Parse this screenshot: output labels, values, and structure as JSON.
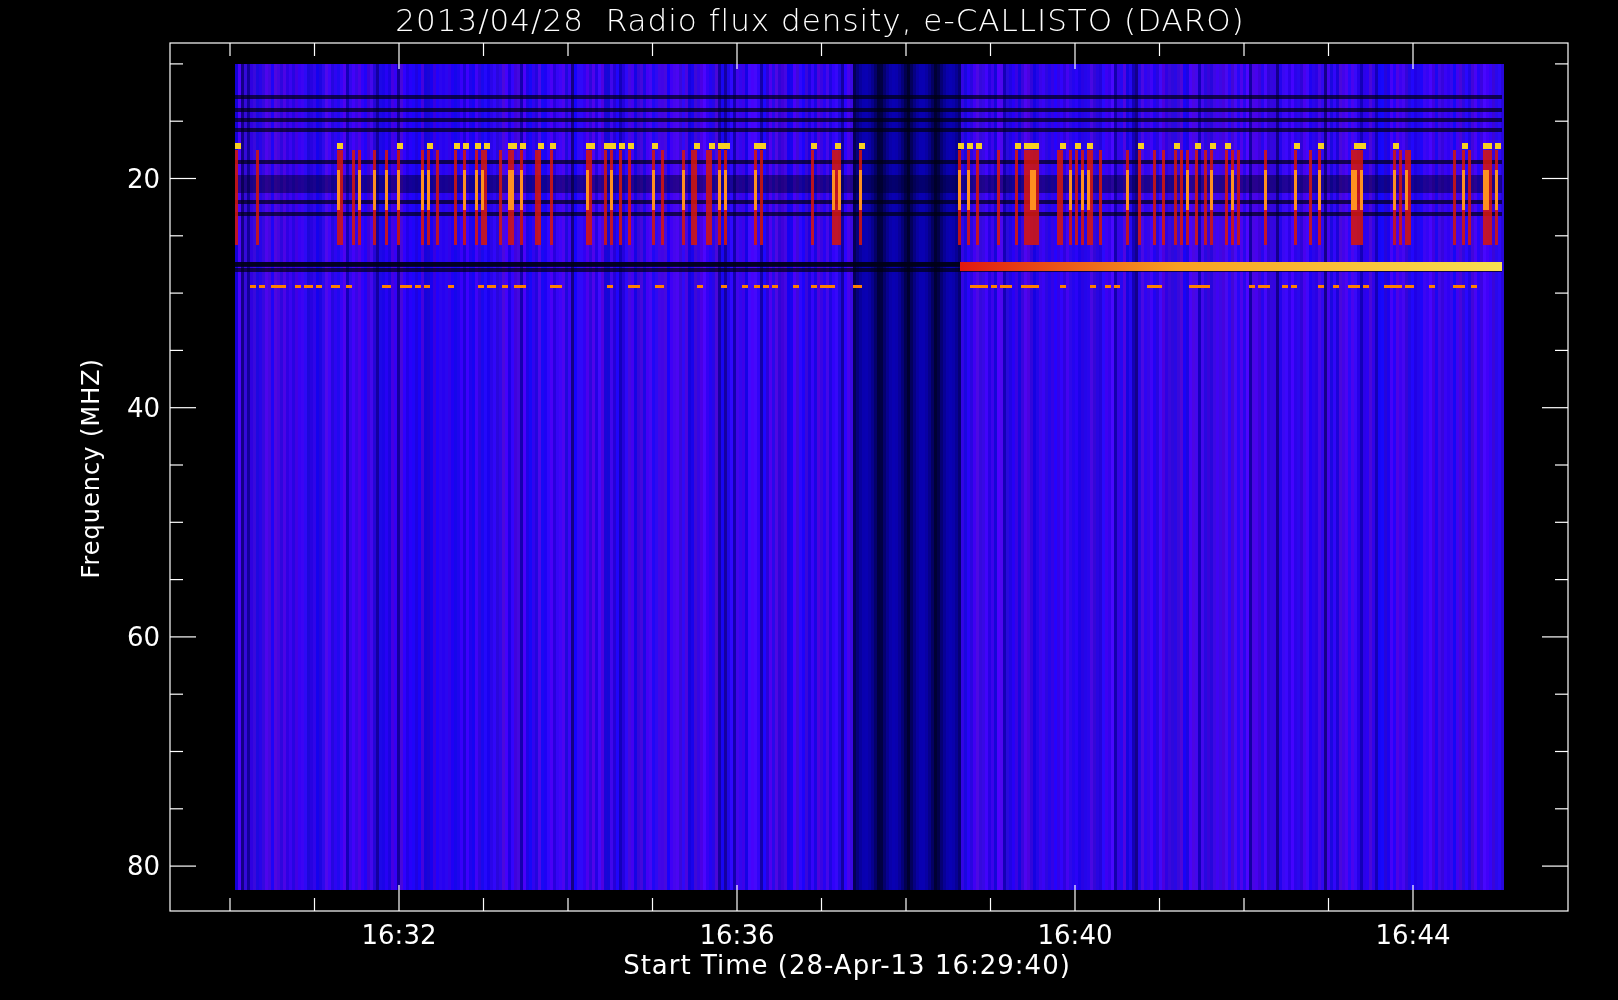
{
  "title": "2013/04/28  Radio flux density, e-CALLISTO (DARO)",
  "y_axis": {
    "label": "Frequency (MHZ)",
    "ticks": [
      "20",
      "40",
      "60",
      "80"
    ]
  },
  "x_axis": {
    "label": "Start Time (28-Apr-13 16:29:40)",
    "ticks": [
      "16:32",
      "16:36",
      "16:40",
      "16:44"
    ]
  }
}
